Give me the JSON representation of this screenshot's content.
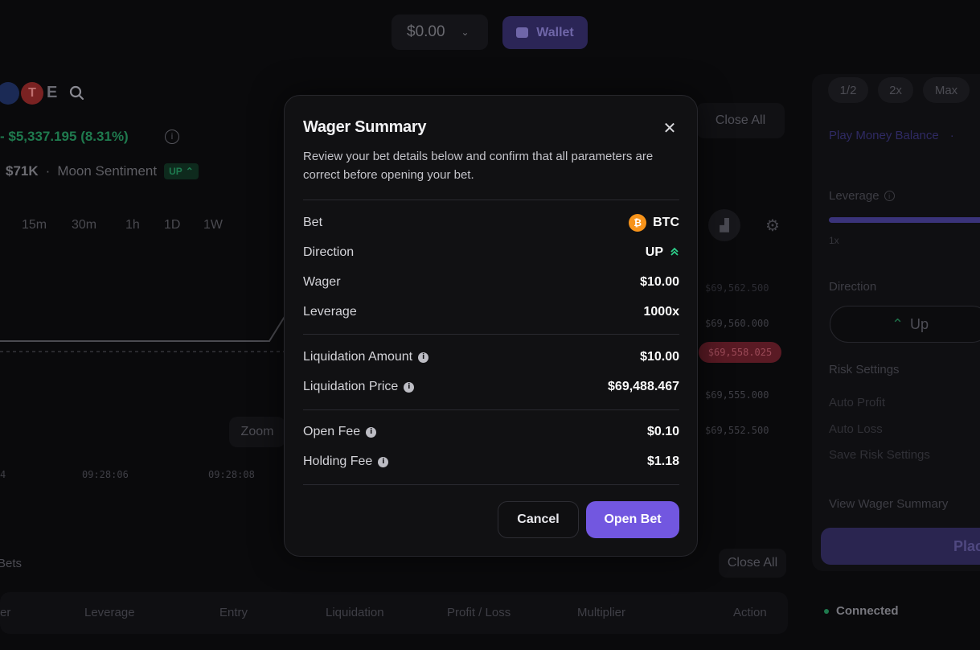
{
  "topbar": {
    "balance": "$0.00",
    "wallet_label": "Wallet"
  },
  "market": {
    "price_change": "- $5,337.195 (8.31%)",
    "stat_value": "$71K",
    "sentiment_label": "Moon Sentiment",
    "sentiment_badge": "UP",
    "timeframes": [
      "15m",
      "30m",
      "1h",
      "1D",
      "1W"
    ],
    "price_axis": [
      "$69,562.500",
      "$69,560.000",
      "$69,555.000",
      "$69,552.500"
    ],
    "current_price_tag": "$69,558.025",
    "time_axis": [
      "4",
      "09:28:06",
      "09:28:08"
    ],
    "zoom_label": "Zoom",
    "close_all_label": "Close All"
  },
  "bets": {
    "section_label": "Bets",
    "close_all_label": "Close All",
    "columns": [
      "er",
      "Leverage",
      "Entry",
      "Liquidation",
      "Profit / Loss",
      "Multiplier",
      "Action"
    ]
  },
  "panel": {
    "chips": [
      "1/2",
      "2x",
      "Max"
    ],
    "play_balance": "Play Money Balance",
    "leverage_label": "Leverage",
    "leverage_min": "1x",
    "direction_label": "Direction",
    "up_label": "Up",
    "risk_settings": "Risk Settings",
    "auto_profit": "Auto Profit",
    "auto_loss": "Auto Loss",
    "save_risk": "Save Risk Settings",
    "view_summary": "View Wager Summary",
    "place_label": "Place",
    "status": "Connected"
  },
  "modal": {
    "title": "Wager Summary",
    "description": "Review your bet details below and confirm that all parameters are correct before opening your bet.",
    "rows": {
      "bet": {
        "label": "Bet",
        "value": "BTC"
      },
      "direction": {
        "label": "Direction",
        "value": "UP"
      },
      "wager": {
        "label": "Wager",
        "value": "$10.00"
      },
      "leverage": {
        "label": "Leverage",
        "value": "1000x"
      },
      "liq_amount": {
        "label": "Liquidation Amount",
        "value": "$10.00"
      },
      "liq_price": {
        "label": "Liquidation Price",
        "value": "$69,488.467"
      },
      "open_fee": {
        "label": "Open Fee",
        "value": "$0.10"
      },
      "holding_fee": {
        "label": "Holding Fee",
        "value": "$1.18"
      }
    },
    "cancel_label": "Cancel",
    "open_label": "Open Bet"
  },
  "colors": {
    "accent": "#7257e0",
    "up": "#2ecf8a",
    "btc": "#f7931a"
  }
}
